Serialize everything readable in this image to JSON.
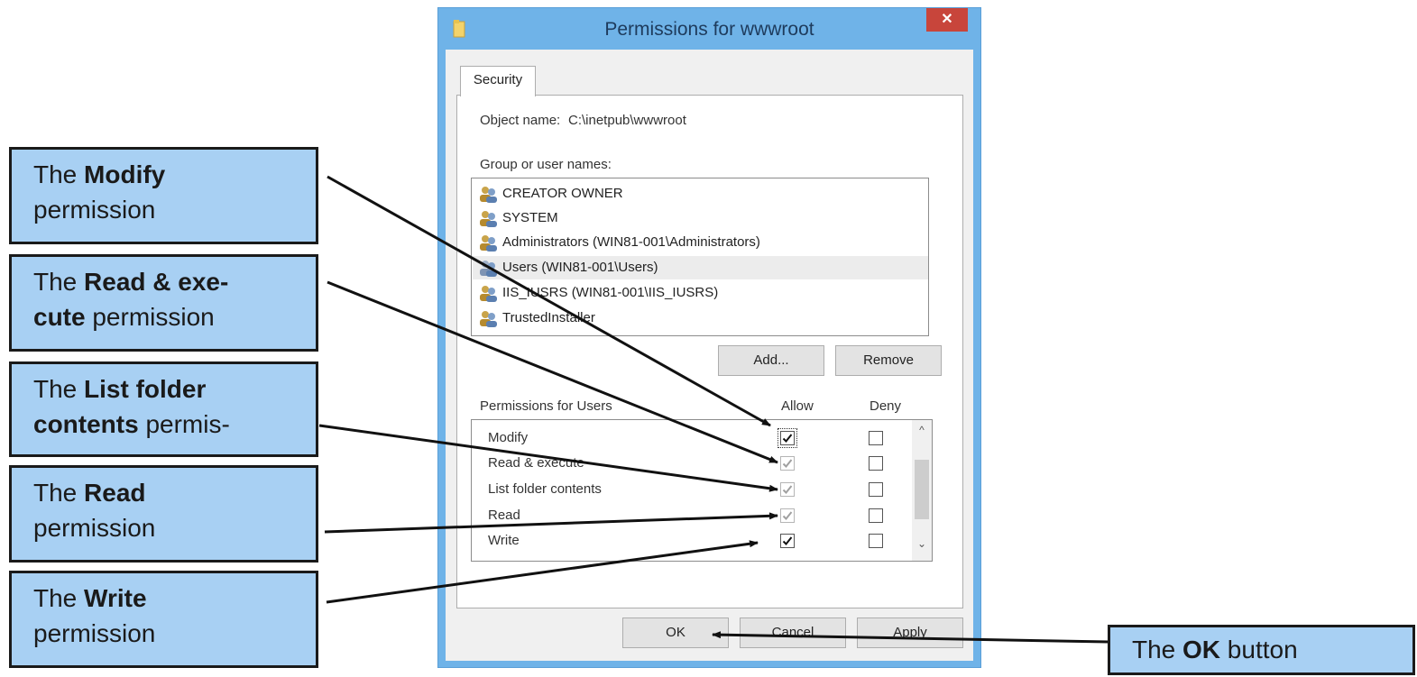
{
  "window": {
    "title": "Permissions for wwwroot",
    "close_glyph": "✕",
    "icon": "folder-icon"
  },
  "tab": {
    "label": "Security"
  },
  "object": {
    "label": "Object name:",
    "value": "C:\\inetpub\\wwwroot"
  },
  "groups": {
    "label": "Group or user names:",
    "items": [
      {
        "name": "CREATOR OWNER",
        "icon": "users-icon"
      },
      {
        "name": "SYSTEM",
        "icon": "users-icon"
      },
      {
        "name": "Administrators (WIN81-001\\Administrators)",
        "icon": "users-icon"
      },
      {
        "name": "Users (WIN81-001\\Users)",
        "icon": "users-icon",
        "selected": true
      },
      {
        "name": "IIS_IUSRS (WIN81-001\\IIS_IUSRS)",
        "icon": "users-icon"
      },
      {
        "name": "TrustedInstaller",
        "icon": "users-icon"
      }
    ]
  },
  "buttons": {
    "add": "Add...",
    "remove": "Remove",
    "ok": "OK",
    "cancel": "Cancel",
    "apply": "Apply"
  },
  "permissions": {
    "label": "Permissions for Users",
    "allow_header": "Allow",
    "deny_header": "Deny",
    "rows": [
      {
        "name": "Modify",
        "allow": "checked",
        "deny": "unchecked"
      },
      {
        "name": "Read & execute",
        "allow": "checked-inherited",
        "deny": "unchecked"
      },
      {
        "name": "List folder contents",
        "allow": "checked-inherited",
        "deny": "unchecked"
      },
      {
        "name": "Read",
        "allow": "checked-inherited",
        "deny": "unchecked"
      },
      {
        "name": "Write",
        "allow": "checked",
        "deny": "unchecked"
      }
    ]
  },
  "callouts": {
    "modify": {
      "prefix": "The ",
      "bold": "Modify",
      "suffix": "permission"
    },
    "read_execute": {
      "prefix": "The ",
      "bold1": "Read & exe-",
      "bold2": "cute",
      "suffix": " permission"
    },
    "list_folder": {
      "prefix": "The ",
      "bold1": "List folder",
      "bold2": "contents",
      "suffix": " permis-"
    },
    "read": {
      "prefix": "The ",
      "bold": "Read",
      "suffix": "permission"
    },
    "write": {
      "prefix": "The ",
      "bold": "Write",
      "suffix": "permission"
    },
    "ok": {
      "prefix": "The ",
      "bold": "OK",
      "suffix": " button"
    }
  },
  "colors": {
    "titlebar": "#6fb3e8",
    "callout_fill": "#a8d0f3",
    "close_button": "#c8453b"
  }
}
